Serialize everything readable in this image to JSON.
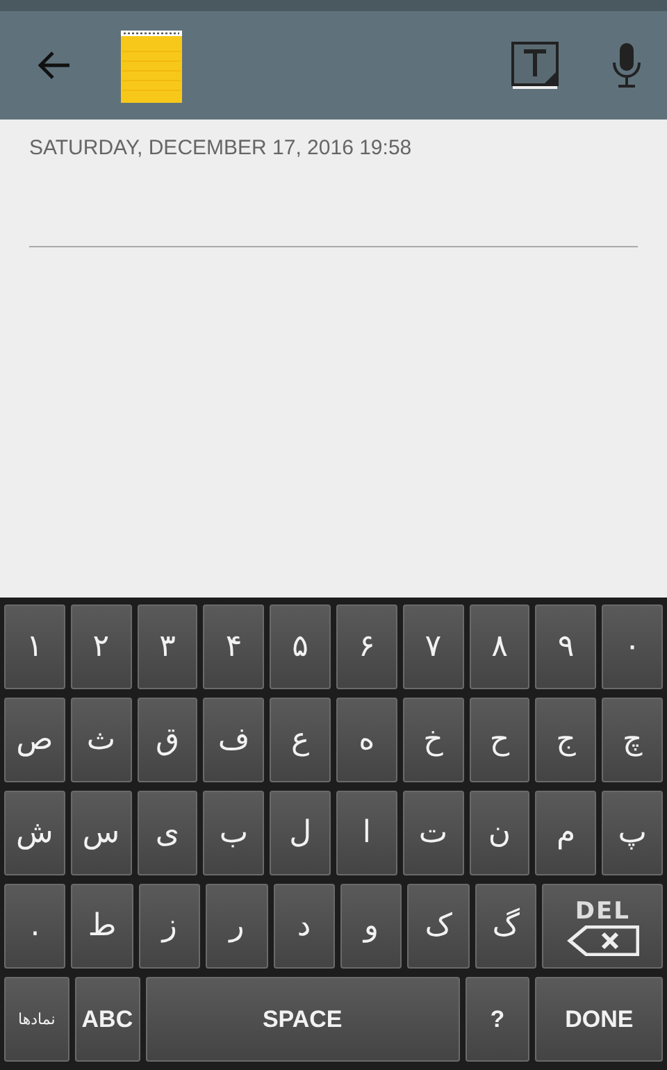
{
  "note": {
    "date": "SATURDAY, DECEMBER 17, 2016 19:58"
  },
  "keyboard": {
    "rows": [
      [
        {
          "kind": "char",
          "label": "۱"
        },
        {
          "kind": "char",
          "label": "۲"
        },
        {
          "kind": "char",
          "label": "۳"
        },
        {
          "kind": "char",
          "label": "۴"
        },
        {
          "kind": "char",
          "label": "۵"
        },
        {
          "kind": "char",
          "label": "۶"
        },
        {
          "kind": "char",
          "label": "۷"
        },
        {
          "kind": "char",
          "label": "۸"
        },
        {
          "kind": "char",
          "label": "۹"
        },
        {
          "kind": "char",
          "label": "۰"
        }
      ],
      [
        {
          "kind": "char",
          "label": "ص"
        },
        {
          "kind": "char",
          "label": "ث"
        },
        {
          "kind": "char",
          "label": "ق"
        },
        {
          "kind": "char",
          "label": "ف"
        },
        {
          "kind": "char",
          "label": "ع"
        },
        {
          "kind": "char",
          "label": "ه"
        },
        {
          "kind": "char",
          "label": "خ"
        },
        {
          "kind": "char",
          "label": "ح"
        },
        {
          "kind": "char",
          "label": "ج"
        },
        {
          "kind": "char",
          "label": "چ"
        }
      ],
      [
        {
          "kind": "char",
          "label": "ش"
        },
        {
          "kind": "char",
          "label": "س"
        },
        {
          "kind": "char",
          "label": "ی"
        },
        {
          "kind": "char",
          "label": "ب"
        },
        {
          "kind": "char",
          "label": "ل"
        },
        {
          "kind": "char",
          "label": "ا"
        },
        {
          "kind": "char",
          "label": "ت"
        },
        {
          "kind": "char",
          "label": "ن"
        },
        {
          "kind": "char",
          "label": "م"
        },
        {
          "kind": "char",
          "label": "پ"
        }
      ],
      [
        {
          "kind": "char",
          "label": "."
        },
        {
          "kind": "char",
          "label": "ط"
        },
        {
          "kind": "char",
          "label": "ز"
        },
        {
          "kind": "char",
          "label": "ر"
        },
        {
          "kind": "char",
          "label": "د"
        },
        {
          "kind": "char",
          "label": "و"
        },
        {
          "kind": "char",
          "label": "ک"
        },
        {
          "kind": "char",
          "label": "گ"
        },
        {
          "kind": "delete",
          "label": "DEL"
        }
      ]
    ],
    "bottom_bar": [
      {
        "kind": "small",
        "label": "نمادها"
      },
      {
        "kind": "mode",
        "label": "ABC"
      },
      {
        "kind": "space",
        "label": "SPACE"
      },
      {
        "kind": "mode",
        "label": "?"
      },
      {
        "kind": "done",
        "label": "DONE"
      }
    ]
  }
}
